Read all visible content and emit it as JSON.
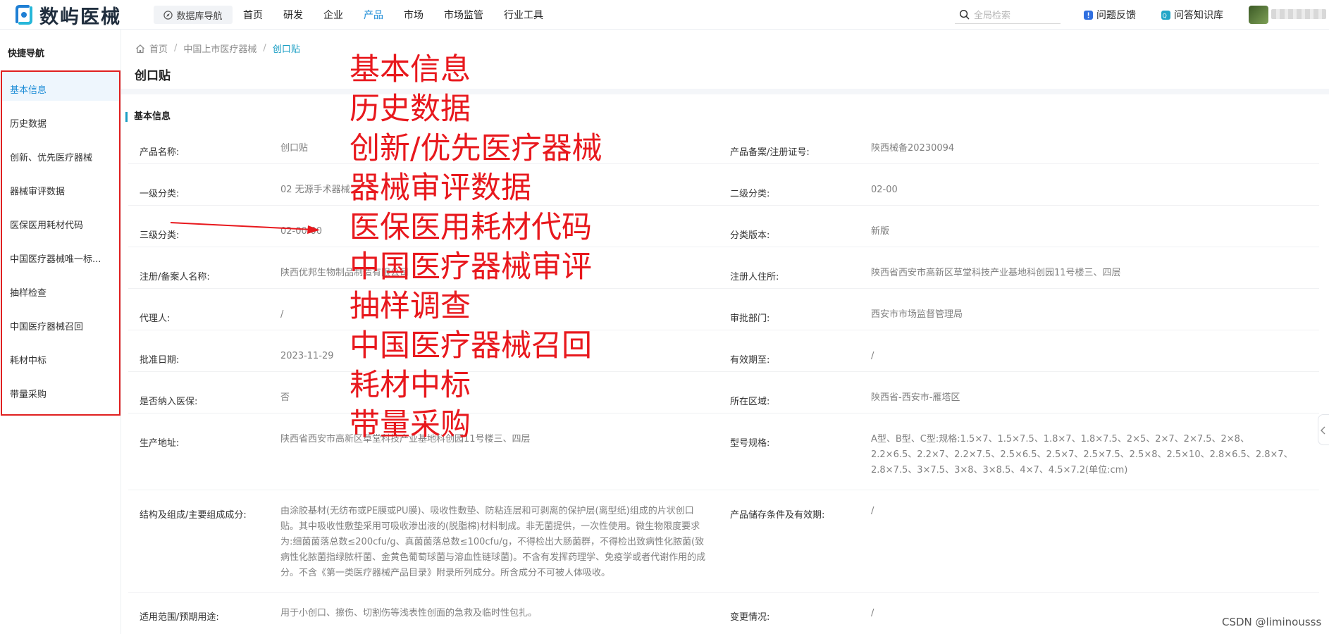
{
  "app": {
    "logo_text": "数屿医械",
    "db_nav_label": "数据库导航",
    "nav": [
      "首页",
      "研发",
      "企业",
      "产品",
      "市场",
      "市场监管",
      "行业工具"
    ],
    "active_nav": "产品",
    "search_placeholder": "全局检索",
    "feedback_label": "问题反馈",
    "kb_label": "问答知识库"
  },
  "sidebar": {
    "title": "快捷导航",
    "items": [
      {
        "label": "基本信息",
        "active": true
      },
      {
        "label": "历史数据"
      },
      {
        "label": "创新、优先医疗器械"
      },
      {
        "label": "器械审评数据"
      },
      {
        "label": "医保医用耗材代码"
      },
      {
        "label": "中国医疗器械唯一标..."
      },
      {
        "label": "抽样检查"
      },
      {
        "label": "中国医疗器械召回"
      },
      {
        "label": "耗材中标"
      },
      {
        "label": "带量采购"
      }
    ]
  },
  "breadcrumb": {
    "home": "首页",
    "level2": "中国上市医疗器械",
    "current": "创口贴"
  },
  "page_title": "创口贴",
  "section_title": "基本信息",
  "fields": {
    "product_name": {
      "label": "产品名称:",
      "value": "创口贴"
    },
    "reg_no": {
      "label": "产品备案/注册证号:",
      "value": "陕西械备20230094"
    },
    "cat1": {
      "label": "一级分类:",
      "value": "02 无源手术器械"
    },
    "cat2": {
      "label": "二级分类:",
      "value": "02-00"
    },
    "cat3": {
      "label": "三级分类:",
      "value": "02-00-00"
    },
    "cat_version": {
      "label": "分类版本:",
      "value": "新版"
    },
    "registrant": {
      "label": "注册/备案人名称:",
      "value": "陕西优邦生物制品制造有限公司"
    },
    "registrant_addr": {
      "label": "注册人住所:",
      "value": "陕西省西安市高新区草堂科技产业基地科创园11号楼三、四层"
    },
    "agent": {
      "label": "代理人:",
      "value": "/"
    },
    "approval_dept": {
      "label": "审批部门:",
      "value": "西安市市场监督管理局"
    },
    "approval_date": {
      "label": "批准日期:",
      "value": "2023-11-29"
    },
    "valid_until": {
      "label": "有效期至:",
      "value": "/"
    },
    "in_insurance": {
      "label": "是否纳入医保:",
      "value": "否"
    },
    "region": {
      "label": "所在区域:",
      "value": "陕西省-西安市-雁塔区"
    },
    "prod_addr": {
      "label": "生产地址:",
      "value": "陕西省西安市高新区草堂科技产业基地科创园11号楼三、四层"
    },
    "model_spec": {
      "label": "型号规格:",
      "value": "A型、B型、C型:规格:1.5×7、1.5×7.5、1.8×7、1.8×7.5、2×5、2×7、2×7.5、2×8、2.2×6.5、2.2×7、2.2×7.5、2.5×6.5、2.5×7、2.5×7.5、2.5×8、2.5×10、2.8×6.5、2.8×7、2.8×7.5、3×7.5、3×8、3×8.5、4×7、4.5×7.2(单位:cm)"
    },
    "structure": {
      "label": "结构及组成/主要组成成分:",
      "value": "由涂胶基材(无纺布或PE膜或PU膜)、吸收性敷垫、防粘连层和可剥离的保护层(离型纸)组成的片状创口贴。其中吸收性敷垫采用可吸收渗出液的(脱脂棉)材料制成。非无菌提供，一次性使用。微生物限度要求为:细菌菌落总数≤200cfu/g、真菌菌落总数≤100cfu/g，不得检出大肠菌群，不得检出致病性化脓菌(致病性化脓菌指绿脓杆菌、金黄色葡萄球菌与溶血性链球菌)。不含有发挥药理学、免疫学或者代谢作用的成分。不含《第一类医疗器械产品目录》附录所列成分。所含成分不可被人体吸收。"
    },
    "storage": {
      "label": "产品储存条件及有效期:",
      "value": "/"
    },
    "usage": {
      "label": "适用范围/预期用途:",
      "value": "用于小创口、擦伤、切割伤等浅表性创面的急救及临时性包扎。"
    },
    "changes": {
      "label": "变更情况:",
      "value": "/"
    }
  },
  "annotations": [
    "基本信息",
    "历史数据",
    "创新/优先医疗器械",
    "器械审评数据",
    "医保医用耗材代码",
    "中国医疗器械审评",
    "抽样调查",
    "中国医疗器械召回",
    "耗材中标",
    "带量采购"
  ],
  "watermark": "CSDN @liminousss",
  "colors": {
    "accent": "#1a9ec4",
    "annotation_red": "#e8181d"
  }
}
